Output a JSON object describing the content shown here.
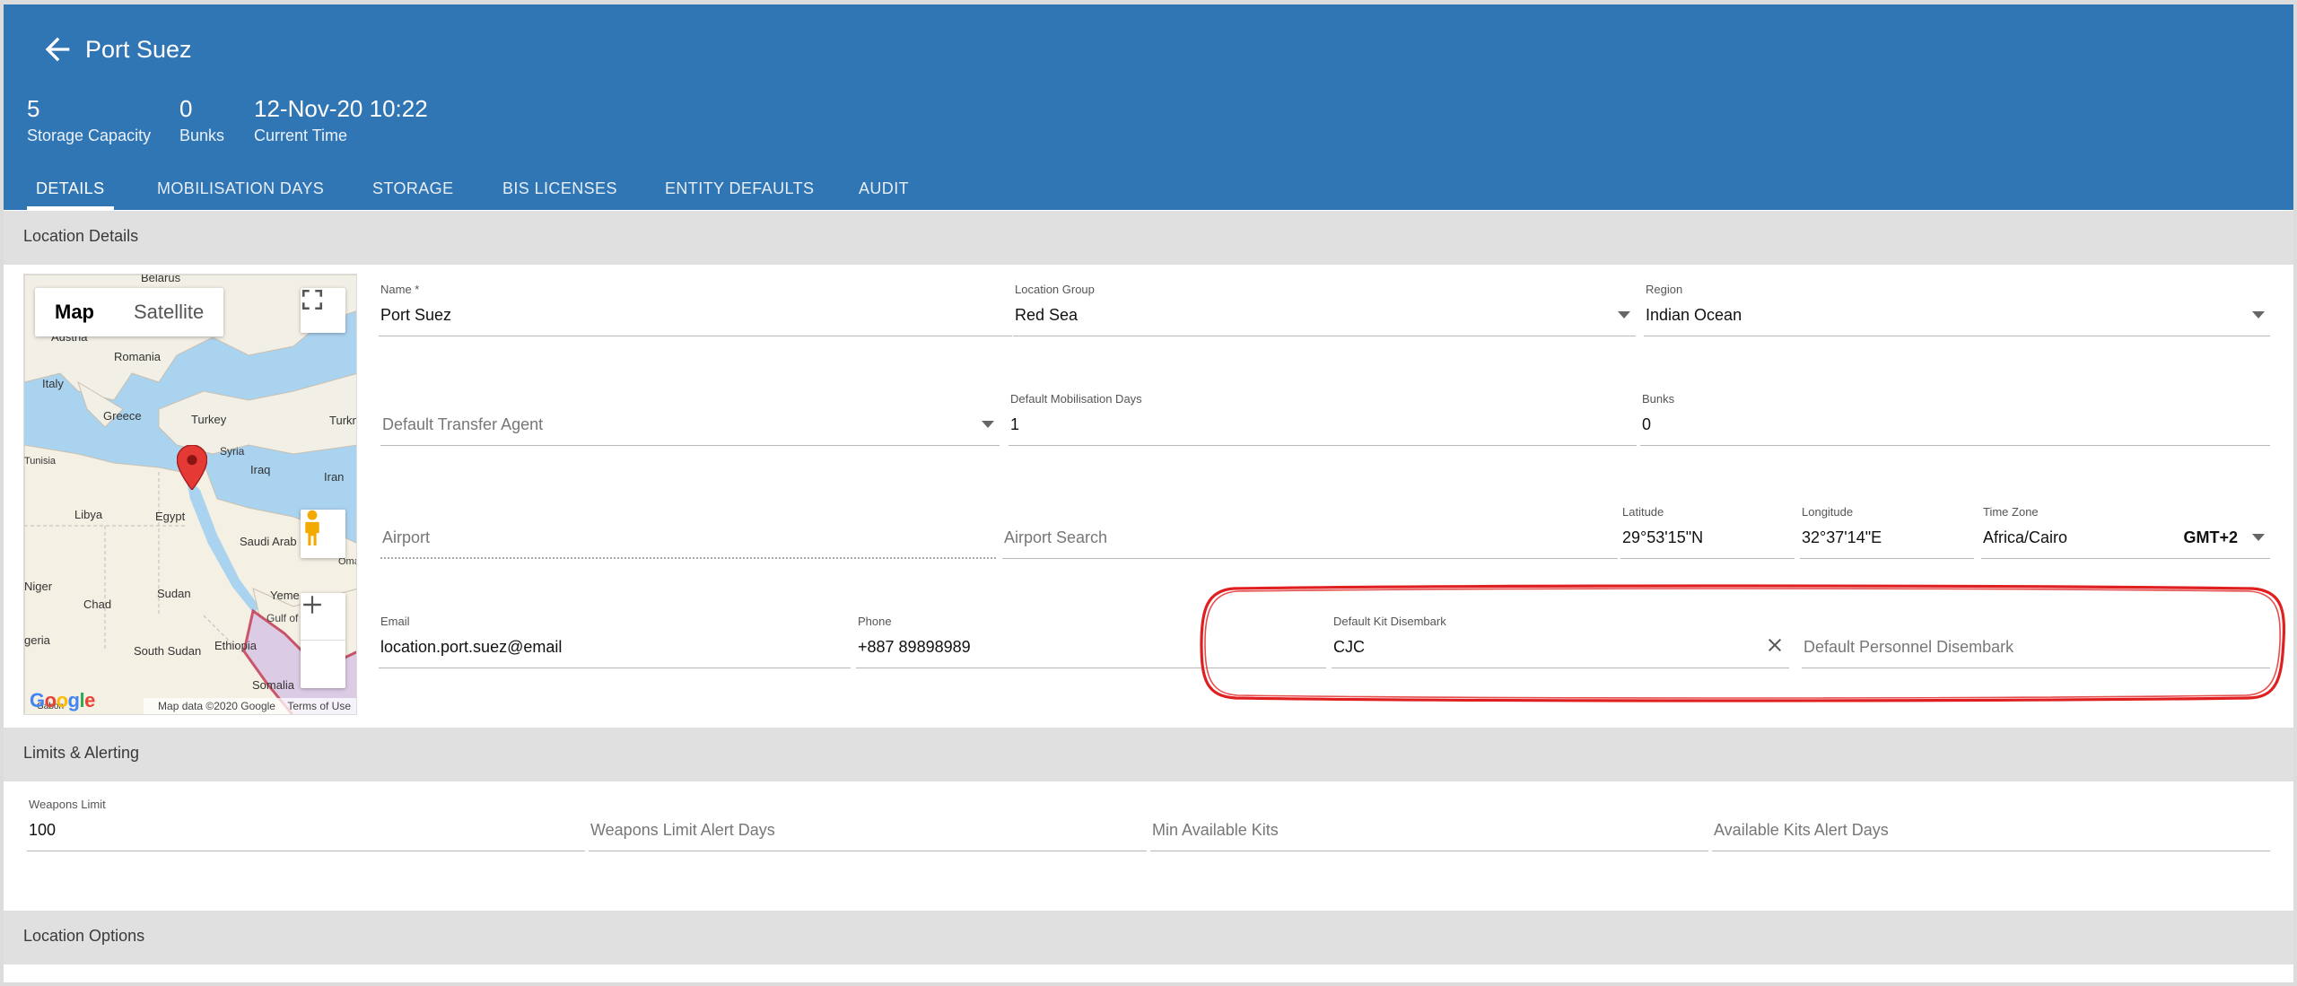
{
  "header": {
    "title": "Port Suez",
    "stats": [
      {
        "value": "5",
        "label": "Storage Capacity"
      },
      {
        "value": "0",
        "label": "Bunks"
      },
      {
        "value": "12-Nov-20 10:22",
        "label": "Current Time"
      }
    ],
    "tabs": [
      {
        "label": "DETAILS",
        "active": true
      },
      {
        "label": "MOBILISATION DAYS"
      },
      {
        "label": "STORAGE"
      },
      {
        "label": "BIS LICENSES"
      },
      {
        "label": "ENTITY DEFAULTS"
      },
      {
        "label": "AUDIT"
      }
    ]
  },
  "sections": {
    "location_details": "Location Details",
    "limits_alerting": "Limits & Alerting",
    "location_options": "Location Options"
  },
  "map": {
    "toggle_map": "Map",
    "toggle_satellite": "Satellite",
    "attribution": "Map data ©2020 Google",
    "terms": "Terms of Use",
    "logo": "Google",
    "places": {
      "belarus": "Belarus",
      "austria": "Austria",
      "romania": "Romania",
      "italy": "Italy",
      "greece": "Greece",
      "turkey": "Turkey",
      "turkmen": "Turkm",
      "tunisia": "Tunisia",
      "syria": "Syria",
      "iraq": "Iraq",
      "iran": "Iran",
      "libya": "Libya",
      "egypt": "Egypt",
      "saudi": "Saudi Arab",
      "oman": "Oman",
      "niger": "Niger",
      "chad": "Chad",
      "sudan": "Sudan",
      "yemen": "Yeme",
      "gulf": "Gulf of",
      "nigeria": "geria",
      "south_sudan": "South Sudan",
      "ethiopia": "Ethiopia",
      "somalia": "Somalia",
      "gabon": "Gabon"
    }
  },
  "details": {
    "name": {
      "label": "Name *",
      "value": "Port Suez"
    },
    "location_group": {
      "label": "Location Group",
      "value": "Red Sea"
    },
    "region": {
      "label": "Region",
      "value": "Indian Ocean"
    },
    "default_transfer_agent": {
      "placeholder": "Default Transfer Agent"
    },
    "default_mobilisation_days": {
      "label": "Default Mobilisation Days",
      "value": "1"
    },
    "bunks": {
      "label": "Bunks",
      "value": "0"
    },
    "airport": {
      "placeholder": "Airport"
    },
    "airport_search": {
      "placeholder": "Airport Search"
    },
    "latitude": {
      "label": "Latitude",
      "value": "29°53'15\"N"
    },
    "longitude": {
      "label": "Longitude",
      "value": "32°37'14\"E"
    },
    "time_zone": {
      "label": "Time Zone",
      "value": "Africa/Cairo",
      "offset": "GMT+2"
    },
    "email": {
      "label": "Email",
      "value": "location.port.suez@email"
    },
    "phone": {
      "label": "Phone",
      "value": "+887 89898989"
    },
    "default_kit_disembark": {
      "label": "Default Kit Disembark",
      "value": "CJC"
    },
    "default_personnel_disembark": {
      "placeholder": "Default Personnel Disembark"
    }
  },
  "limits": {
    "weapons_limit": {
      "label": "Weapons Limit",
      "value": "100"
    },
    "weapons_limit_alert_days": {
      "placeholder": "Weapons Limit Alert Days"
    },
    "min_available_kits": {
      "placeholder": "Min Available Kits"
    },
    "available_kits_alert_days": {
      "placeholder": "Available Kits Alert Days"
    }
  },
  "colors": {
    "header": "#3176b4",
    "section": "#e0e0e0",
    "highlight": "#e02020"
  }
}
